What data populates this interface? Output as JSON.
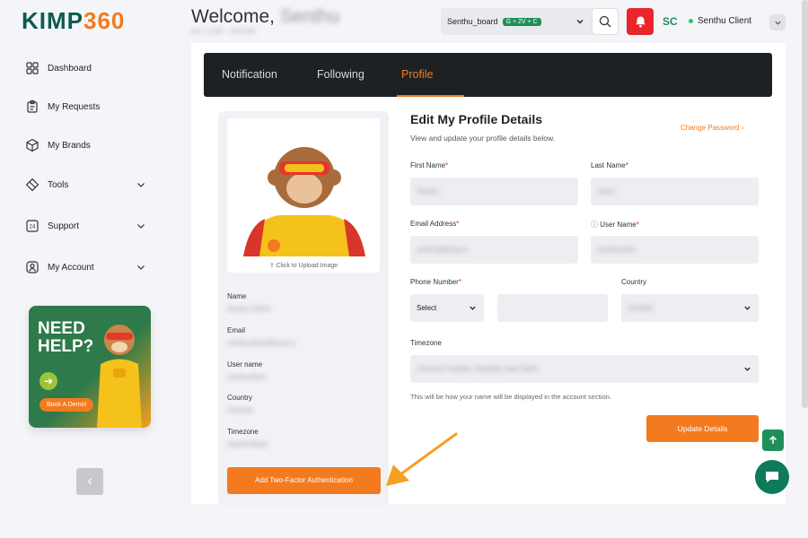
{
  "brand": {
    "logo_a": "KIMP",
    "logo_b": "360"
  },
  "sidebar": {
    "items": [
      {
        "label": "Dashboard",
        "icon": "dashboard-icon"
      },
      {
        "label": "My Requests",
        "icon": "clipboard-icon"
      },
      {
        "label": "My Brands",
        "icon": "cube-icon"
      },
      {
        "label": "Tools",
        "icon": "tools-icon"
      },
      {
        "label": "Support",
        "icon": "support-24-icon"
      },
      {
        "label": "My Account",
        "icon": "user-circle-icon"
      }
    ],
    "help_card": {
      "title_line1": "NEED",
      "title_line2": "HELP?",
      "demo_label": "Book A Demo!"
    }
  },
  "header": {
    "welcome": "Welcome,",
    "user_blurred": "Senthu",
    "sub_blurred": "Nov 1 2025 · 10:00 AM",
    "board": "Senthu_board",
    "board_tag": "G + 2V + C",
    "avatar_initials": "SC",
    "user_name": "Senthu Client"
  },
  "tabs": [
    {
      "label": "Notification"
    },
    {
      "label": "Following"
    },
    {
      "label": "Profile"
    }
  ],
  "profile_card": {
    "upload_label": "Click to Upload Image",
    "name_label": "Name",
    "name_value": "Senthu Client",
    "email_label": "Email",
    "email_value": "senthuclient@kimp.io",
    "username_label": "User name",
    "username_value": "senthuclient",
    "country_label": "Country",
    "country_value": "Canada",
    "timezone_label": "Timezone",
    "timezone_value": "Asia/Kolkata",
    "twofa_label": "Add Two-Factor Authentication"
  },
  "form": {
    "title": "Edit My Profile Details",
    "subtitle": "View and update your profile details below.",
    "change_password": "Change Password",
    "first_name_label": "First Name",
    "first_name_value": "Senthu",
    "last_name_label": "Last Name",
    "last_name_value": "Client",
    "email_label": "Email Address",
    "email_value": "senthu@kimp.io",
    "username_label": "User Name",
    "username_value": "senthuclient",
    "phone_label": "Phone Number",
    "phone_code": "Select",
    "country_label": "Country",
    "country_value": "Canada",
    "timezone_label": "Timezone",
    "timezone_value": "Chennai, Kolkata, Mumbai, New Delhi",
    "hint": "This will be how your name will be displayed in the account section.",
    "update_label": "Update Details"
  },
  "colors": {
    "accent": "#f47a20",
    "brand_green": "#1f8f5a",
    "tab_bg": "#1e2124",
    "alert": "#e8262b"
  }
}
